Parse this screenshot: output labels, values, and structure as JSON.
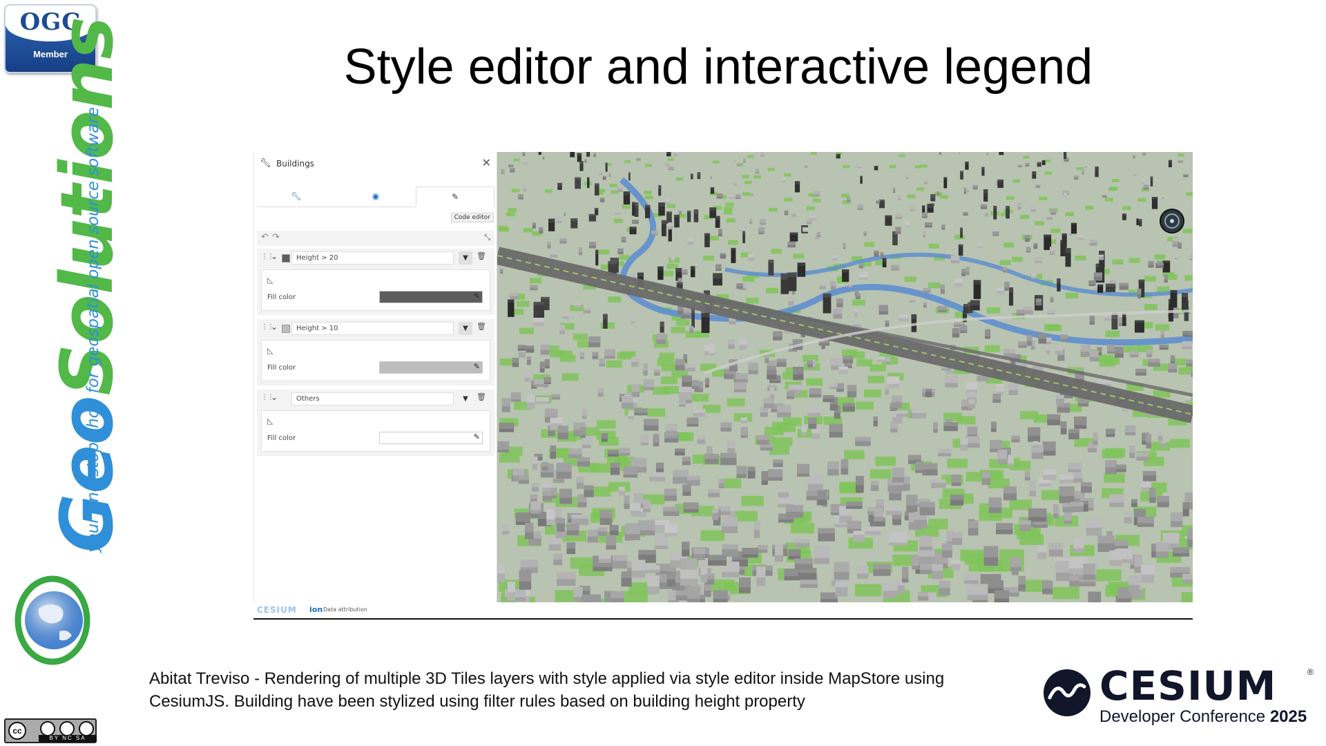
{
  "ogc": {
    "acronym": "OGC",
    "member": "Member"
  },
  "brand": {
    "name_part1": "Geo",
    "name_part2": "Solutions",
    "tagline": "your one-stop-shop for geospatial open source software"
  },
  "license": {
    "cc": "cc",
    "labels": "BY NC SA"
  },
  "title": "Style editor and interactive legend",
  "panel": {
    "title": "Buildings",
    "tooltip": "Code editor",
    "field_label": "Fill color",
    "rules": [
      {
        "name": "Height > 20",
        "color": "#5d5d5d"
      },
      {
        "name": "Height > 10",
        "color": "#bdbdbd"
      },
      {
        "name": "Others",
        "color": "#ffffff"
      }
    ],
    "footer": {
      "cesium": "CESIUM",
      "ion": "ion",
      "attribution": "Data attribution"
    }
  },
  "map": {
    "colors": {
      "ground": "#b9c3b1",
      "trees": "#7fc45a",
      "buildings": "#8d8d8d",
      "roads": "#6a6a6a",
      "river": "#5e8fd0"
    }
  },
  "caption": {
    "line1": "Abitat Treviso - Rendering of multiple 3D Tiles layers with style applied via style editor inside MapStore using",
    "line2": "CesiumJS. Building have been stylized using filter rules based on building height property"
  },
  "cesium": {
    "word": "CESIUM",
    "reg": "®",
    "subtitle": "Developer Conference",
    "year": "2025"
  }
}
